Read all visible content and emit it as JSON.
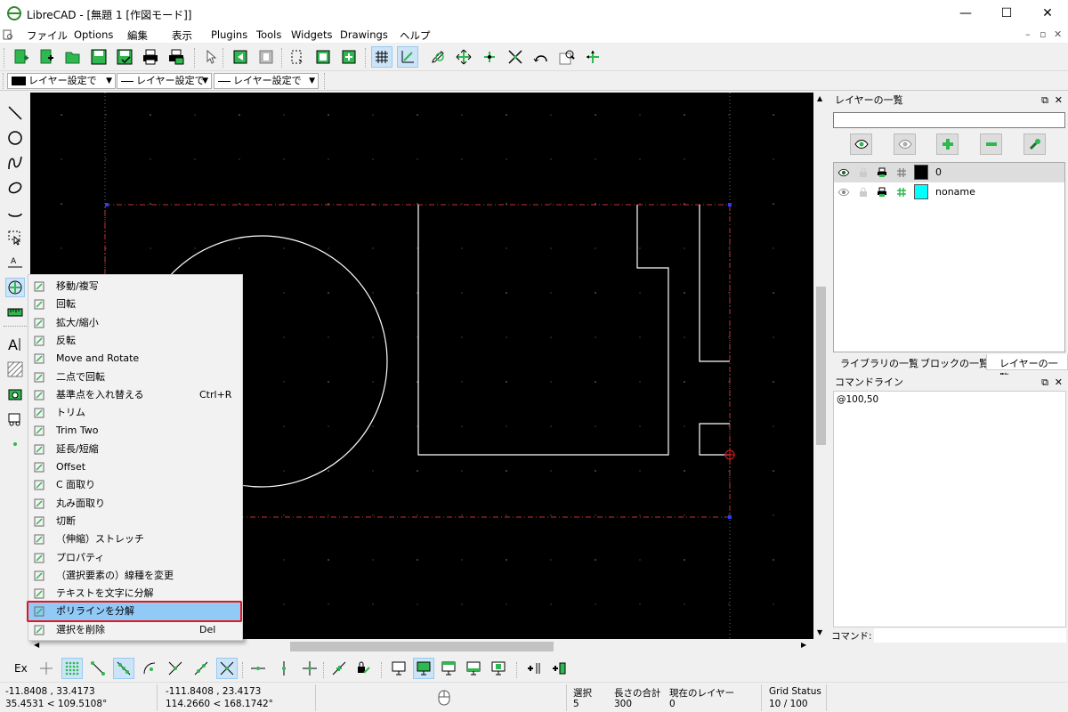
{
  "window": {
    "title": "LibreCAD - [無題 1 [作図モード]]",
    "minimize": "—",
    "maximize": "☐",
    "close": "✕"
  },
  "menu": {
    "items": [
      "ファイル",
      "Options",
      "編集",
      "表示",
      "Plugins",
      "Tools",
      "Widgets",
      "Drawings",
      "ヘルプ"
    ],
    "mdi_min": "–",
    "mdi_restore": "▫",
    "mdi_close": "✕"
  },
  "pen_toolbar": {
    "color_combo": "レイヤー設定で",
    "width_combo": "レイヤー設定で",
    "type_combo": "レイヤー設定で"
  },
  "layer_panel": {
    "title": "レイヤーの一覧",
    "search_value": "",
    "layers": [
      {
        "name": "0",
        "color": "#000000"
      },
      {
        "name": "noname",
        "color": "#00ffff"
      }
    ]
  },
  "panel_tabs": [
    "ライブラリの一覧",
    "ブロックの一覧",
    "レイヤーの一覧"
  ],
  "command_panel": {
    "title": "コマンドライン",
    "history": "@100,50",
    "prompt_label": "コマンド:"
  },
  "context_menu": {
    "items": [
      {
        "label": "移動/複写",
        "shortcut": ""
      },
      {
        "label": "回転",
        "shortcut": ""
      },
      {
        "label": "拡大/縮小",
        "shortcut": ""
      },
      {
        "label": "反転",
        "shortcut": ""
      },
      {
        "label": "Move and Rotate",
        "shortcut": ""
      },
      {
        "label": "二点で回転",
        "shortcut": ""
      },
      {
        "label": "基準点を入れ替える",
        "shortcut": "Ctrl+R"
      },
      {
        "label": "トリム",
        "shortcut": ""
      },
      {
        "label": "Trim Two",
        "shortcut": ""
      },
      {
        "label": "延長/短縮",
        "shortcut": ""
      },
      {
        "label": "Offset",
        "shortcut": ""
      },
      {
        "label": "C 面取り",
        "shortcut": ""
      },
      {
        "label": "丸み面取り",
        "shortcut": ""
      },
      {
        "label": "切断",
        "shortcut": ""
      },
      {
        "label": "（伸縮）ストレッチ",
        "shortcut": ""
      },
      {
        "label": "プロパティ",
        "shortcut": ""
      },
      {
        "label": "（選択要素の）線種を変更",
        "shortcut": ""
      },
      {
        "label": "テキストを文字に分解",
        "shortcut": ""
      },
      {
        "label": "ポリラインを分解",
        "shortcut": ""
      },
      {
        "label": "選択を削除",
        "shortcut": "Del"
      }
    ],
    "highlighted_index": 18
  },
  "snap_toolbar": {
    "exclusive_label": "Ex"
  },
  "status": {
    "abs_coord": "-11.8408 , 33.4173",
    "abs_polar": "35.4531 < 109.5108°",
    "rel_coord": "-111.8408 , 23.4173",
    "rel_polar": "114.2660 < 168.1742°",
    "selected_label": "選択",
    "selected_value": "5",
    "length_label": "長さの合計",
    "length_value": "300",
    "layer_label": "現在のレイヤー",
    "layer_value": "0",
    "grid_label": "Grid Status",
    "grid_value": "10 / 100"
  }
}
